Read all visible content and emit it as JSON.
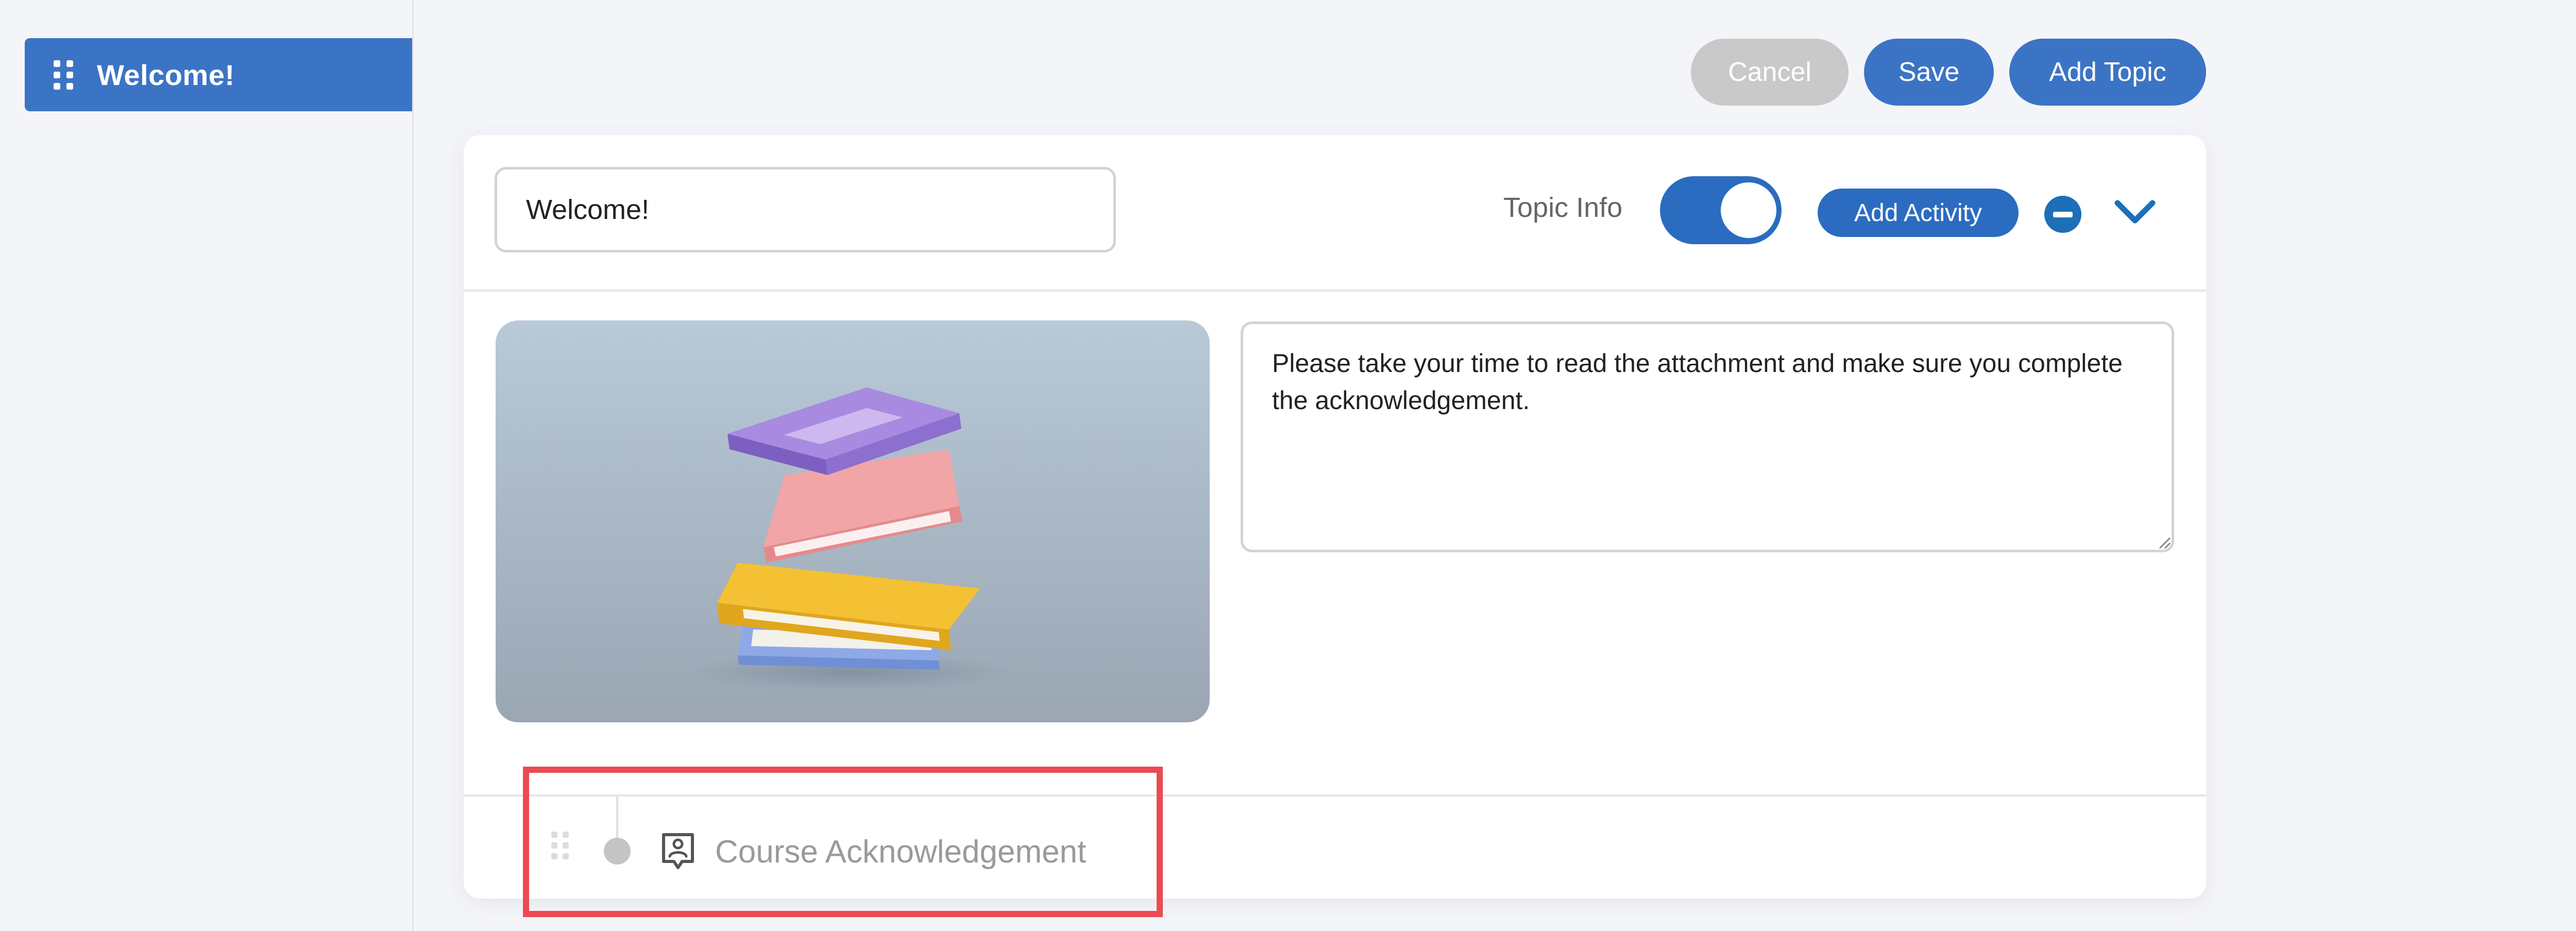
{
  "sidebar": {
    "items": [
      {
        "label": "Welcome!",
        "icon": "drag-handle-icon",
        "active": true
      }
    ]
  },
  "toolbar": {
    "cancel_label": "Cancel",
    "save_label": "Save",
    "add_topic_label": "Add Topic"
  },
  "topic": {
    "title_value": "Welcome!",
    "topic_info_label": "Topic Info",
    "topic_info_enabled": true,
    "add_activity_label": "Add Activity",
    "remove_icon": "minus-circle-icon",
    "collapse_icon": "chevron-down-icon",
    "cover_image": "books-stack-illustration",
    "description": "Please take your time to read the attachment and make sure you complete the acknowledgement."
  },
  "activities": [
    {
      "label": "Course Acknowledgement",
      "icon": "acknowledgement-icon"
    }
  ],
  "colors": {
    "primary": "#3c74c5",
    "toggle": "#2b6cc0",
    "cancel": "#c9c9c9",
    "highlight": "#ec4a52",
    "background": "#f4f5f9"
  }
}
